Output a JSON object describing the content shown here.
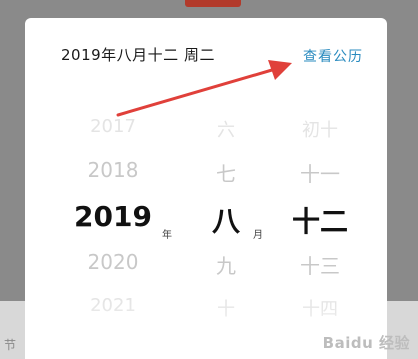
{
  "dialog": {
    "date_label": "2019年八月十二 周二",
    "gregorian_link": "查看公历"
  },
  "picker": {
    "years": [
      "2017",
      "2018",
      "2019",
      "2020",
      "2021"
    ],
    "year_unit": "年",
    "months": [
      "六",
      "七",
      "八",
      "九",
      "十"
    ],
    "month_unit": "月",
    "days": [
      "初十",
      "十一",
      "十二",
      "十三",
      "十四"
    ]
  },
  "watermark": "Baidu 经验",
  "colors": {
    "link": "#2a8bbf",
    "arrow": "#e0403a",
    "top_tab": "#b23a2b"
  }
}
